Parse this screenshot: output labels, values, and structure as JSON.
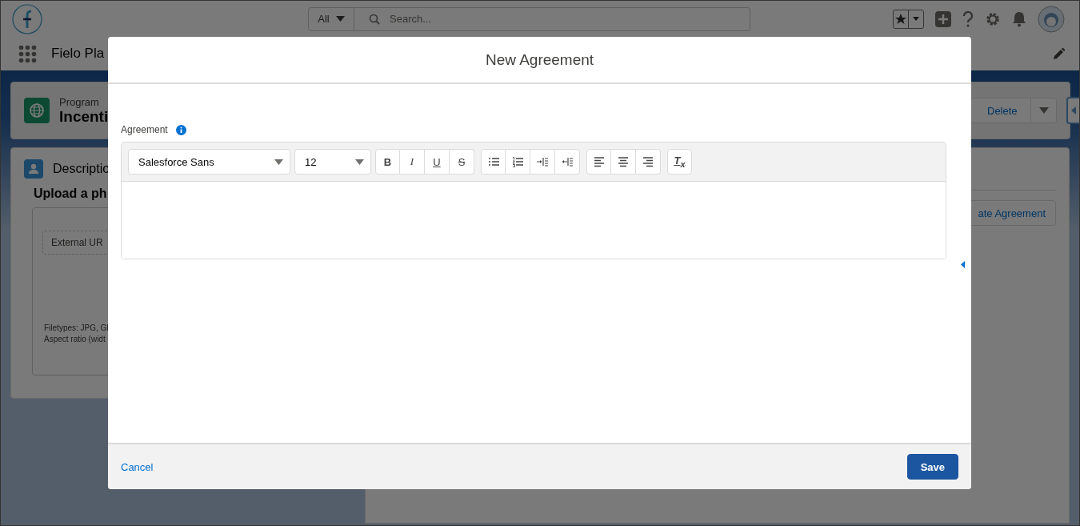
{
  "global_header": {
    "scope": "All",
    "search_placeholder": "Search...",
    "app_name": "Fielo Pla"
  },
  "record_header": {
    "object_label": "Program",
    "record_name": "Incenti",
    "actions": [
      "Delete"
    ]
  },
  "description_card": {
    "title": "Descriptio",
    "upload_title": "Upload a ph",
    "url_placeholder": "External UR",
    "hints": [
      "Filetypes: JPG, GI",
      "Aspect ratio (widt"
    ]
  },
  "related_action": "ate Agreement",
  "modal": {
    "title": "New Agreement",
    "field_label": "Agreement",
    "font_family": "Salesforce Sans",
    "font_size": "12",
    "toolbar_groups": [
      [
        {
          "kind": "bold",
          "glyph": "B"
        },
        {
          "kind": "italic",
          "glyph": "I"
        },
        {
          "kind": "underline",
          "glyph": "U"
        },
        {
          "kind": "strike",
          "glyph": "S"
        }
      ],
      [
        {
          "kind": "bullets"
        },
        {
          "kind": "numbers"
        },
        {
          "kind": "indent"
        },
        {
          "kind": "outdent"
        }
      ],
      [
        {
          "kind": "align-left"
        },
        {
          "kind": "align-center"
        },
        {
          "kind": "align-right"
        }
      ],
      [
        {
          "kind": "clear",
          "glyph": "T$_{x}$"
        }
      ]
    ],
    "cancel": "Cancel",
    "save": "Save"
  }
}
